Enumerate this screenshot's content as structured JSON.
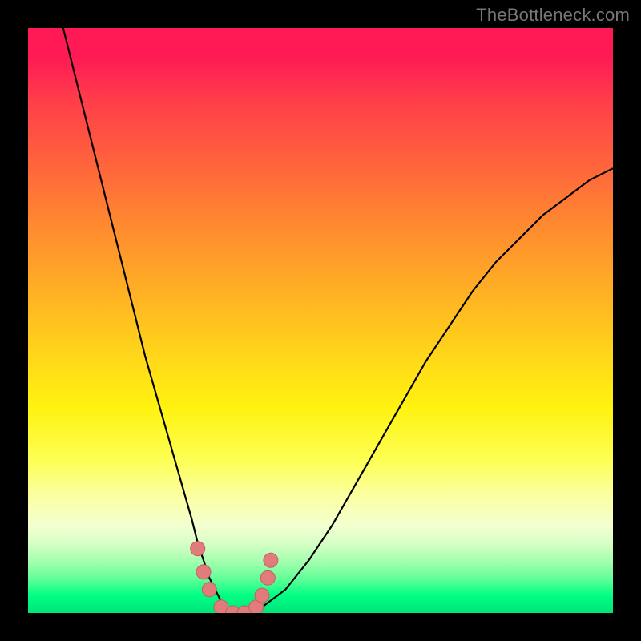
{
  "watermark": "TheBottleneck.com",
  "chart_data": {
    "type": "line",
    "title": "",
    "xlabel": "",
    "ylabel": "",
    "xlim": [
      0,
      100
    ],
    "ylim": [
      0,
      100
    ],
    "grid": false,
    "legend": false,
    "series": [
      {
        "name": "bottleneck-curve",
        "color": "#000000",
        "x": [
          6,
          8,
          10,
          12,
          14,
          16,
          18,
          20,
          22,
          24,
          26,
          28,
          29,
          30,
          31,
          32,
          33,
          34,
          36,
          38,
          40,
          44,
          48,
          52,
          56,
          60,
          64,
          68,
          72,
          76,
          80,
          84,
          88,
          92,
          96,
          100
        ],
        "y": [
          100,
          92,
          84,
          76,
          68,
          60,
          52,
          44,
          37,
          30,
          23,
          16,
          12,
          9,
          6,
          4,
          2,
          1,
          0,
          0,
          1,
          4,
          9,
          15,
          22,
          29,
          36,
          43,
          49,
          55,
          60,
          64,
          68,
          71,
          74,
          76
        ]
      },
      {
        "name": "min-markers",
        "type": "scatter",
        "color": "#e27b7b",
        "x": [
          29,
          30,
          31,
          33,
          35,
          37,
          39,
          40,
          41,
          41.5
        ],
        "y": [
          11,
          7,
          4,
          1,
          0,
          0,
          1,
          3,
          6,
          9
        ]
      }
    ],
    "annotations": []
  },
  "colors": {
    "curve": "#000000",
    "marker_fill": "#e27b7b",
    "marker_stroke": "#c06060",
    "frame_bg": "#000000"
  }
}
